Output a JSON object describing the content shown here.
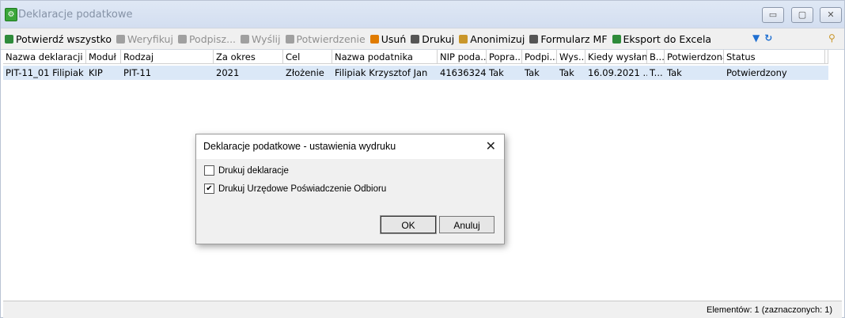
{
  "window": {
    "title": "Deklaracje podatkowe"
  },
  "toolbar": {
    "items": [
      {
        "label": "Potwierdź wszystko",
        "enabled": true,
        "icon": "confirm-all-icon",
        "color": "#2e8b3a"
      },
      {
        "label": "Weryfikuj",
        "enabled": false,
        "icon": "verify-icon",
        "color": "#a0a0a0"
      },
      {
        "label": "Podpisz...",
        "enabled": false,
        "icon": "sign-icon",
        "color": "#a0a0a0"
      },
      {
        "label": "Wyślij",
        "enabled": false,
        "icon": "send-icon",
        "color": "#a0a0a0"
      },
      {
        "label": "Potwierdzenie",
        "enabled": false,
        "icon": "receipt-icon",
        "color": "#a0a0a0"
      },
      {
        "label": "Usuń",
        "enabled": true,
        "icon": "delete-icon",
        "color": "#e07b00"
      },
      {
        "label": "Drukuj",
        "enabled": true,
        "icon": "print-icon",
        "color": "#555555"
      },
      {
        "label": "Anonimizuj",
        "enabled": true,
        "icon": "anonymize-icon",
        "color": "#c9962a"
      },
      {
        "label": "Formularz MF",
        "enabled": true,
        "icon": "print-form-icon",
        "color": "#555555"
      },
      {
        "label": "Eksport do Excela",
        "enabled": true,
        "icon": "excel-icon",
        "color": "#2e8b3a"
      }
    ]
  },
  "grid": {
    "columns": [
      "Nazwa deklaracji",
      "Moduł",
      "Rodzaj",
      "Za okres",
      "Cel",
      "Nazwa podatnika",
      "NIP poda...",
      "Popra...",
      "Podpi...",
      "Wys...",
      "Kiedy wysłana",
      "B...",
      "Potwierdzona",
      "Status"
    ],
    "rows": [
      [
        "PIT-11_01 Filipiak ...",
        "KIP",
        "PIT-11",
        "2021",
        "Złożenie",
        "Filipiak Krzysztof Jan",
        "41636324...",
        "Tak",
        "Tak",
        "Tak",
        "16.09.2021 ...",
        "T...",
        "Tak",
        "Potwierdzony"
      ]
    ]
  },
  "status": {
    "text": "Elementów: 1 (zaznaczonych: 1)"
  },
  "dialog": {
    "title": "Deklaracje podatkowe - ustawienia wydruku",
    "options": [
      {
        "label": "Drukuj deklaracje",
        "checked": false
      },
      {
        "label": "Drukuj Urzędowe Poświadczenie Odbioru",
        "checked": true
      }
    ],
    "ok_label": "OK",
    "cancel_label": "Anuluj"
  }
}
